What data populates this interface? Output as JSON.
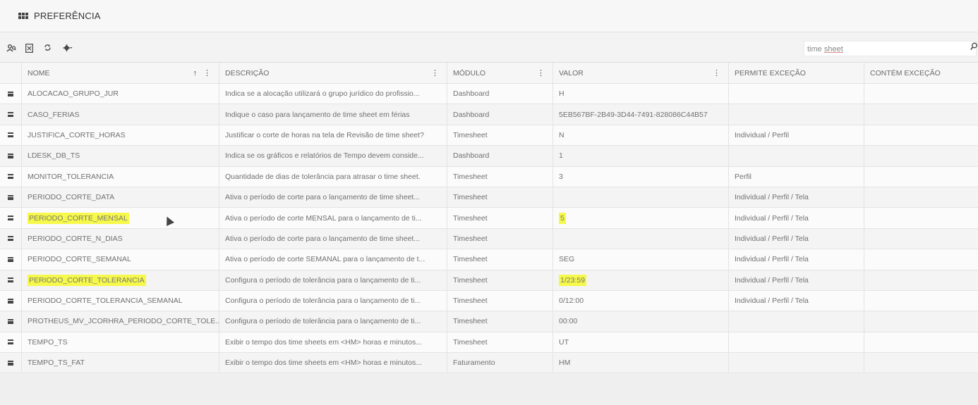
{
  "header": {
    "title": "PREFERÊNCIA"
  },
  "toolbar": {
    "search_value": "time sheet",
    "search_value_a": "time ",
    "search_value_b": "sheet"
  },
  "columns": {
    "nome": "NOME",
    "descricao": "DESCRIÇÃO",
    "modulo": "MÓDULO",
    "valor": "VALOR",
    "permite": "PERMITE EXCEÇÃO",
    "contem": "CONTÉM EXCEÇÃO",
    "sort_indicator": "↑"
  },
  "rows": [
    {
      "nome": "ALOCACAO_GRUPO_JUR",
      "descricao": "Indica se a alocação utilizará o grupo jurídico do profissio...",
      "modulo": "Dashboard",
      "valor": "H",
      "permite": "",
      "contem": ""
    },
    {
      "nome": "CASO_FERIAS",
      "descricao": "Indique o caso para lançamento de time sheet em férias",
      "modulo": "Dashboard",
      "valor": "5EB567BF-2B49-3D44-7491-828086C44B57",
      "permite": "",
      "contem": ""
    },
    {
      "nome": "JUSTIFICA_CORTE_HORAS",
      "descricao": "Justificar o corte de horas na tela de Revisão de time sheet?",
      "modulo": "Timesheet",
      "valor": "N",
      "permite": "Individual / Perfil",
      "contem": ""
    },
    {
      "nome": "LDESK_DB_TS",
      "descricao": "Indica se os gráficos e relatórios de Tempo devem conside...",
      "modulo": "Dashboard",
      "valor": "1",
      "permite": "",
      "contem": ""
    },
    {
      "nome": "MONITOR_TOLERANCIA",
      "descricao": "Quantidade de dias de tolerância para atrasar o time sheet.",
      "modulo": "Timesheet",
      "valor": "3",
      "permite": "Perfil",
      "contem": ""
    },
    {
      "nome": "PERIODO_CORTE_DATA",
      "descricao": "Ativa o período de corte para o lançamento de time sheet...",
      "modulo": "Timesheet",
      "valor": "",
      "permite": "Individual / Perfil / Tela",
      "contem": ""
    },
    {
      "nome": "PERIODO_CORTE_MENSAL",
      "descricao": "Ativa o período de corte MENSAL para o lançamento de ti...",
      "modulo": "Timesheet",
      "valor": "5",
      "permite": "Individual / Perfil / Tela",
      "contem": "",
      "highlight": true
    },
    {
      "nome": "PERIODO_CORTE_N_DIAS",
      "descricao": "Ativa o período de corte para o lançamento de time sheet...",
      "modulo": "Timesheet",
      "valor": "",
      "permite": "Individual / Perfil / Tela",
      "contem": ""
    },
    {
      "nome": "PERIODO_CORTE_SEMANAL",
      "descricao": "Ativa o período de corte SEMANAL para o lançamento de t...",
      "modulo": "Timesheet",
      "valor": "SEG",
      "permite": "Individual / Perfil / Tela",
      "contem": ""
    },
    {
      "nome": "PERIODO_CORTE_TOLERANCIA",
      "descricao": "Configura o período de tolerância para o lançamento de ti...",
      "modulo": "Timesheet",
      "valor": "1/23:59",
      "permite": "Individual / Perfil / Tela",
      "contem": "",
      "highlight": true
    },
    {
      "nome": "PERIODO_CORTE_TOLERANCIA_SEMANAL",
      "descricao": "Configura o período de tolerância para o lançamento de ti...",
      "modulo": "Timesheet",
      "valor": "0/12:00",
      "permite": "Individual / Perfil / Tela",
      "contem": ""
    },
    {
      "nome": "PROTHEUS_MV_JCORHRA_PERIODO_CORTE_TOLE...",
      "descricao": "Configura o período de tolerância para o lançamento de ti...",
      "modulo": "Timesheet",
      "valor": "00:00",
      "permite": "",
      "contem": ""
    },
    {
      "nome": "TEMPO_TS",
      "descricao": "Exibir o tempo dos time sheets em <HM> horas e minutos...",
      "modulo": "Timesheet",
      "valor": "UT",
      "permite": "",
      "contem": ""
    },
    {
      "nome": "TEMPO_TS_FAT",
      "descricao": "Exibir o tempo dos time sheets em <HM> horas e minutos...",
      "modulo": "Faturamento",
      "valor": "HM",
      "permite": "",
      "contem": ""
    }
  ],
  "colors": {
    "highlight": "#f6f94a",
    "header_bg": "#f7f7f7"
  },
  "icons": [
    "apps-grid-icon",
    "user-search-icon",
    "export-excel-icon",
    "refresh-icon",
    "gear-icon",
    "chevron-down-icon",
    "search-icon",
    "row-menu-icon",
    "column-menu-icon",
    "mouse-cursor"
  ]
}
